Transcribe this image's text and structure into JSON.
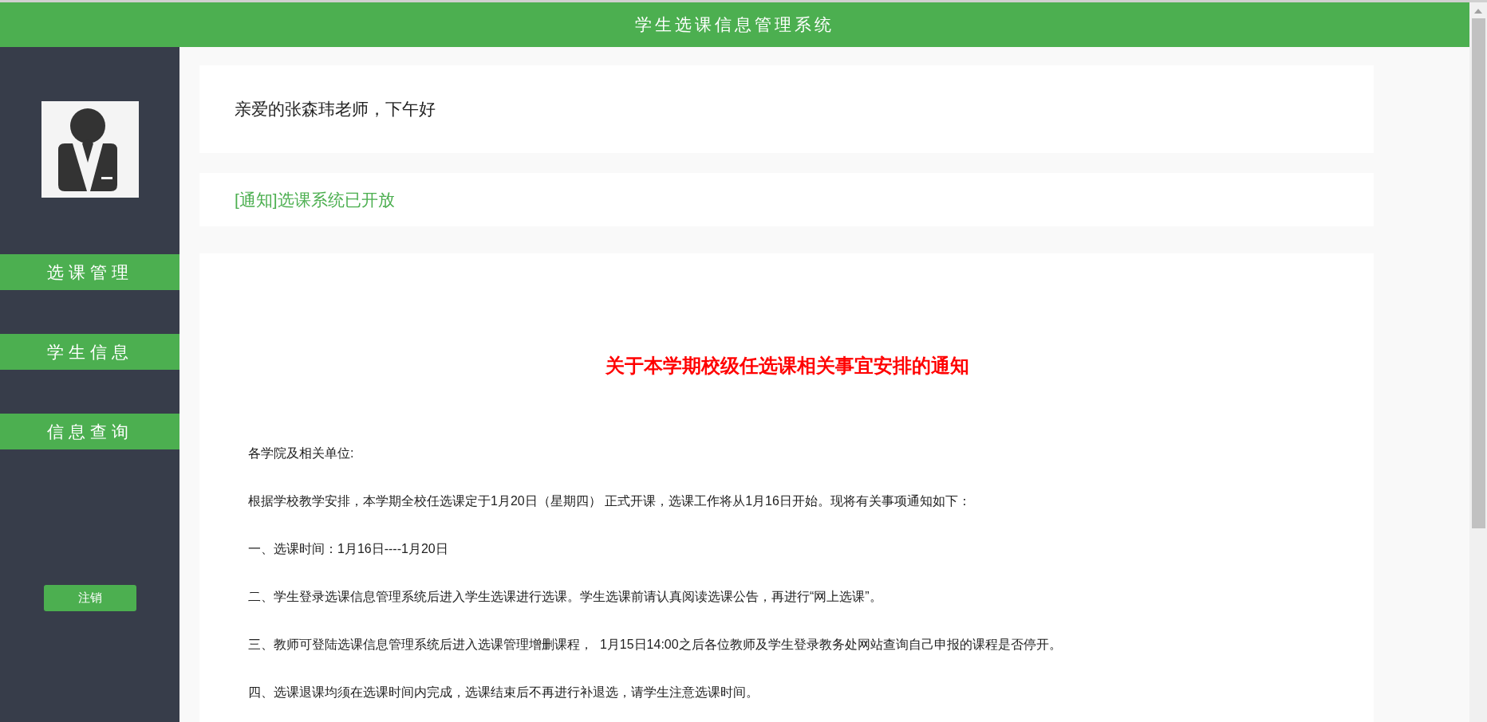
{
  "header": {
    "title": "学生选课信息管理系统"
  },
  "sidebar": {
    "items": [
      {
        "label": "选课管理"
      },
      {
        "label": "学生信息"
      },
      {
        "label": "信息查询"
      }
    ],
    "logout": "注销"
  },
  "greeting": "亲爱的张森玮老师，下午好",
  "notice_link": "[通知]选课系统已开放",
  "article": {
    "title": "关于本学期校级任选课相关事宜安排的通知",
    "paragraphs": [
      "各学院及相关单位:",
      "根据学校教学安排，本学期全校任选课定于1月20日（星期四） 正式开课，选课工作将从1月16日开始。现将有关事项通知如下：",
      "一、选课时间：1月16日----1月20日",
      "二、学生登录选课信息管理系统后进入学生选课进行选课。学生选课前请认真阅读选课公告，再进行“网上选课”。",
      "三、教师可登陆选课信息管理系统后进入选课管理增删课程，  1月15日14:00之后各位教师及学生登录教务处网站查询自己申报的课程是否停开。",
      "四、选课退课均须在选课时间内完成，选课结束后不再进行补退选，请学生注意选课时间。"
    ]
  }
}
